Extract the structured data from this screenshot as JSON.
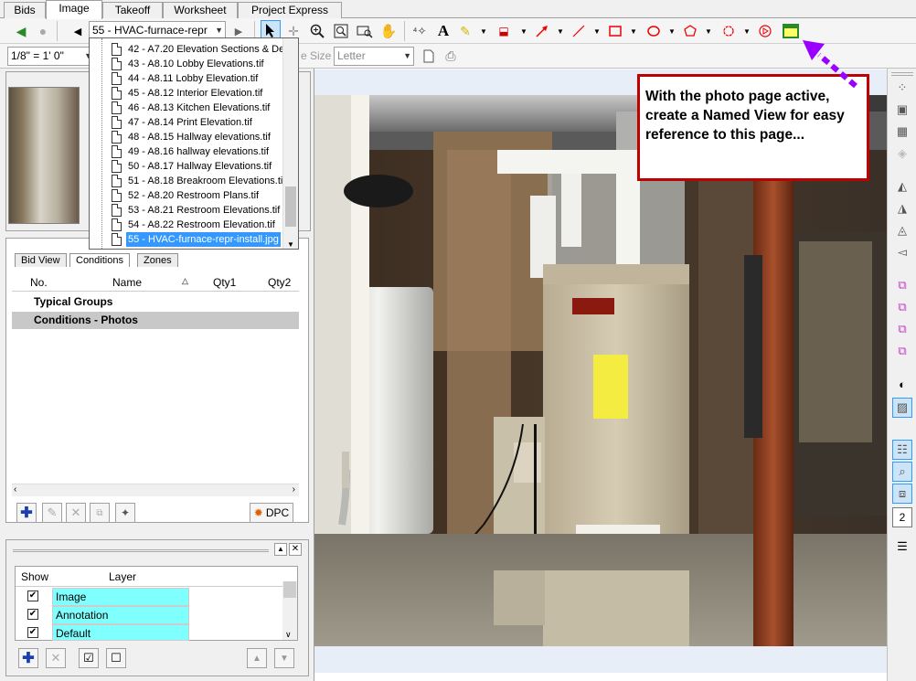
{
  "tabs": [
    {
      "label": "Bids"
    },
    {
      "label": "Image"
    },
    {
      "label": "Takeoff"
    },
    {
      "label": "Worksheet"
    },
    {
      "label": "Project Express"
    }
  ],
  "toolbar": {
    "page_selector_value": "55 - HVAC-furnace-repr",
    "scale_value": "1/8\" = 1' 0\"",
    "page_size_label": "e Size",
    "paper_value": "Letter"
  },
  "page_list": [
    {
      "label": "42 - A7.20 Elevation Sections & Det"
    },
    {
      "label": "43 - A8.10 Lobby Elevations.tif"
    },
    {
      "label": "44 - A8.11 Lobby Elevation.tif"
    },
    {
      "label": "45 - A8.12 Interior Elevation.tif"
    },
    {
      "label": "46 - A8.13 Kitchen Elevations.tif"
    },
    {
      "label": "47 - A8.14 Print Elevation.tif"
    },
    {
      "label": "48 - A8.15 Hallway elevations.tif"
    },
    {
      "label": "49 - A8.16 hallway elevations.tif"
    },
    {
      "label": "50 - A8.17 Hallway Elevations.tif"
    },
    {
      "label": "51 - A8.18 Breakroom Elevations.tif"
    },
    {
      "label": "52 - A8.20 Restroom Plans.tif"
    },
    {
      "label": "53 - A8.21 Restroom Elevations.tif"
    },
    {
      "label": "54 - A8.22 Restroom Elevation.tif"
    },
    {
      "label": "55 - HVAC-furnace-repr-install.jpg"
    }
  ],
  "left_panel": {
    "subtabs": [
      {
        "label": "Bid View"
      },
      {
        "label": "Conditions"
      },
      {
        "label": "Zones"
      }
    ],
    "grid_headers": {
      "no": "No.",
      "name": "Name",
      "qty1": "Qty1",
      "qty2": "Qty2"
    },
    "groups": [
      {
        "label": "Typical Groups"
      },
      {
        "label": "Conditions - Photos"
      }
    ],
    "dpc_label": "DPC",
    "layers_header": {
      "show": "Show",
      "layer": "Layer"
    },
    "layers": [
      {
        "name": "Image",
        "checked": true
      },
      {
        "name": "Annotation",
        "checked": true
      },
      {
        "name": "Default",
        "checked": true
      }
    ]
  },
  "callout": {
    "text": "With the photo page active, create a Named View for easy reference to this page..."
  },
  "icons": [
    "back-icon",
    "forward-icon",
    "prev-page-icon",
    "next-page-icon",
    "select-arrow-icon",
    "crosshair-icon",
    "zoom-icon",
    "zoom-window-icon",
    "zoom-fit-icon",
    "pan-hand-icon",
    "text-icon",
    "highlighter-icon",
    "arrow-line-icon",
    "line-icon",
    "rectangle-icon",
    "ellipse-icon",
    "polygon-icon",
    "cloud-icon",
    "stamp-icon",
    "named-view-icon",
    "page-icon",
    "print-icon"
  ],
  "colors": {
    "accent": "#3399ff",
    "callout_border": "#c00000",
    "layer_highlight": "#80ffff",
    "arrow": "#9900ff"
  },
  "right_bar": {
    "page_number": "2"
  }
}
